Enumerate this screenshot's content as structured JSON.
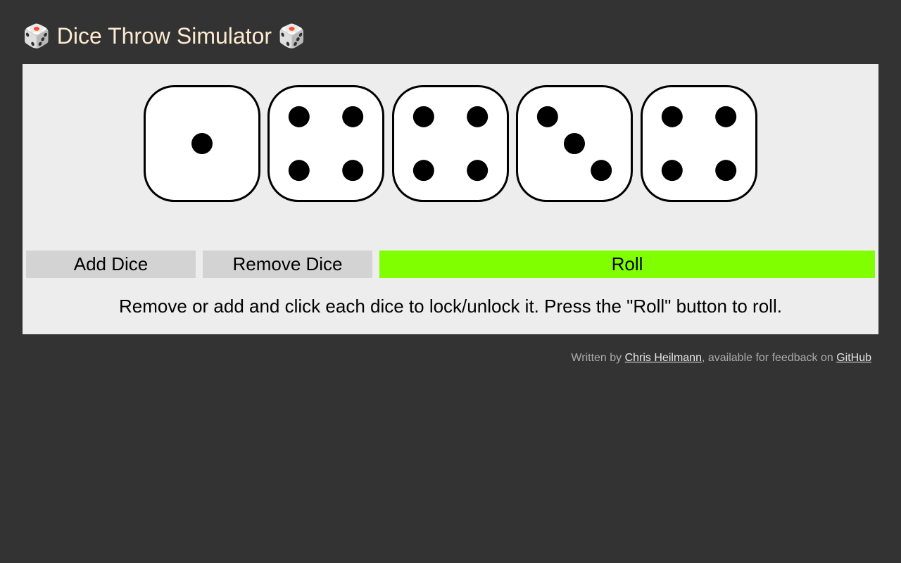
{
  "header": {
    "title_prefix_glyph": "🎲",
    "title": "Dice Throw Simulator",
    "title_suffix_glyph": "🎲",
    "title_color": "#fdebd0"
  },
  "dice": [
    {
      "value": 1,
      "locked": false
    },
    {
      "value": 4,
      "locked": false
    },
    {
      "value": 4,
      "locked": false
    },
    {
      "value": 3,
      "locked": false
    },
    {
      "value": 4,
      "locked": false
    }
  ],
  "controls": {
    "add_label": "Add Dice",
    "remove_label": "Remove Dice",
    "roll_label": "Roll",
    "roll_color": "#7fff00",
    "gray_button_color": "#d3d3d3"
  },
  "instructions": "Remove or add and click each dice to lock/unlock it. Press the \"Roll\" button to roll.",
  "footer": {
    "prefix": "Written by ",
    "author_link": "Chris Heilmann",
    "middle": ", available for feedback on ",
    "github_link": "GitHub"
  },
  "colors": {
    "page_background": "#333333",
    "panel_background": "#ededed"
  }
}
